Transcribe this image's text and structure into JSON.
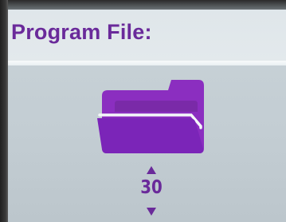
{
  "header": {
    "title": "Program File:"
  },
  "main": {
    "icon": "folder-icon",
    "stepper": {
      "value": "30",
      "up_icon": "arrow-up-icon",
      "down_icon": "arrow-down-icon"
    }
  },
  "colors": {
    "accent": "#6a2a9a",
    "screen_background": "#c5cfd5",
    "header_background": "#e1e7ea"
  }
}
